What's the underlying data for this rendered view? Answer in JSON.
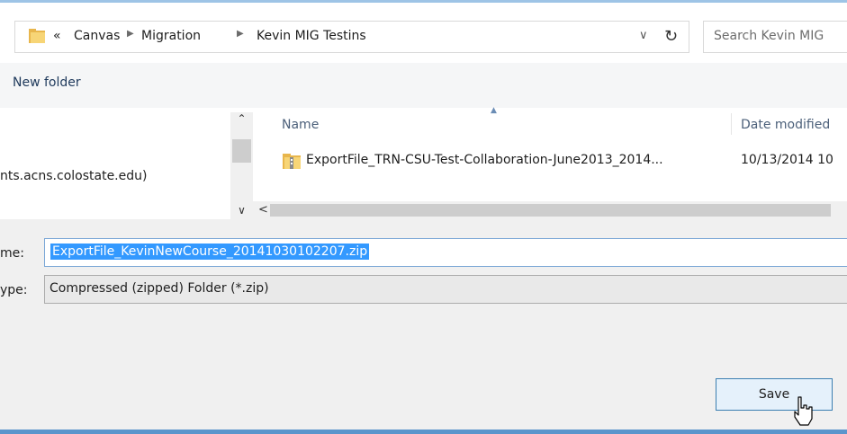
{
  "address_bar": {
    "overflow": "«",
    "crumbs": [
      "Canvas",
      "Migration",
      "Kevin MIG Testins"
    ]
  },
  "search": {
    "placeholder": "Search Kevin MIG"
  },
  "toolbar": {
    "new_folder_label": "New folder"
  },
  "nav_pane": {
    "item_text": "nts.acns.colostate.edu)"
  },
  "file_list": {
    "columns": {
      "name": "Name",
      "date_modified": "Date modified"
    },
    "rows": [
      {
        "name": "ExportFile_TRN-CSU-Test-Collaboration-June2013_2014...",
        "date": "10/13/2014 10"
      }
    ]
  },
  "form": {
    "file_name_label": "me:",
    "file_name_value": "ExportFile_KevinNewCourse_20141030102207.zip",
    "save_type_label": "ype:",
    "save_type_value": "Compressed (zipped) Folder (*.zip)"
  },
  "buttons": {
    "save_label": "Save"
  },
  "icons": {
    "folder": "folder-icon",
    "zip": "zip-folder-icon",
    "refresh": "refresh-icon",
    "dropdown": "chevron-down-icon",
    "cursor": "mouse-cursor-icon"
  },
  "colors": {
    "selection": "#3399ff",
    "accent_border": "#5b95cc",
    "button_bg": "#e5f1fb"
  }
}
